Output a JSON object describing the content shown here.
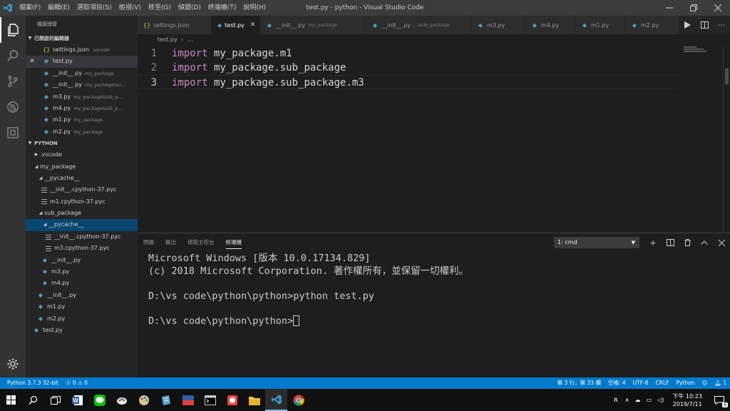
{
  "window": {
    "title": "test.py - python - Visual Studio Code",
    "menus": [
      "檔案(F)",
      "編輯(E)",
      "選取項目(S)",
      "檢視(V)",
      "移至(G)",
      "偵錯(D)",
      "終端機(T)",
      "說明(H)"
    ]
  },
  "sidebar": {
    "title": "檔案總管",
    "open_editors_header": "已開啟的編輯器",
    "open_editors": [
      {
        "name": "settings.json",
        "path": ".vscode",
        "icon": "json-braces-icon"
      },
      {
        "name": "test.py",
        "path": "",
        "icon": "python-icon",
        "close": "✕"
      },
      {
        "name": "__init__.py",
        "path": "my_package",
        "icon": "python-icon"
      },
      {
        "name": "__init__.py",
        "path": "my_package\\su...",
        "icon": "python-icon"
      },
      {
        "name": "m3.py",
        "path": "my_package\\sub_p...",
        "icon": "python-icon"
      },
      {
        "name": "m4.py",
        "path": "my_package\\sub_p...",
        "icon": "python-icon"
      },
      {
        "name": "m1.py",
        "path": "my_package",
        "icon": "python-icon"
      },
      {
        "name": "m2.py",
        "path": "my_package",
        "icon": "python-icon"
      }
    ],
    "folder_header": "PYTHON",
    "tree": [
      {
        "name": ".vscode",
        "kind": "folder-closed"
      },
      {
        "name": "my_package",
        "kind": "folder-open"
      },
      {
        "name": "__pycache__",
        "kind": "folder-open"
      },
      {
        "name": "__init__.cpython-37.pyc",
        "kind": "file-lines"
      },
      {
        "name": "m1.cpython-37.pyc",
        "kind": "file-lines"
      },
      {
        "name": "sub_package",
        "kind": "folder-open"
      },
      {
        "name": "__pycache__",
        "kind": "folder-open"
      },
      {
        "name": "__init__.cpython-37.pyc",
        "kind": "file-lines"
      },
      {
        "name": "m3.cpython-37.pyc",
        "kind": "file-lines"
      },
      {
        "name": "__init__.py",
        "kind": "python"
      },
      {
        "name": "m3.py",
        "kind": "python"
      },
      {
        "name": "m4.py",
        "kind": "python"
      },
      {
        "name": "__init__.py",
        "kind": "python"
      },
      {
        "name": "m1.py",
        "kind": "python"
      },
      {
        "name": "m2.py",
        "kind": "python"
      },
      {
        "name": "test.py",
        "kind": "python"
      }
    ]
  },
  "tabs": [
    {
      "name": "settings.json",
      "path": "",
      "icon": "json-braces-icon"
    },
    {
      "name": "test.py",
      "path": "",
      "icon": "python-icon",
      "close": "✕"
    },
    {
      "name": "__init__.py",
      "path": "my_package",
      "icon": "python-icon"
    },
    {
      "name": "__init__.py",
      "path": "...\\sub_package",
      "icon": "python-icon"
    },
    {
      "name": "m3.py",
      "path": "",
      "icon": "python-icon"
    },
    {
      "name": "m4.py",
      "path": "",
      "icon": "python-icon"
    },
    {
      "name": "m1.py",
      "path": "",
      "icon": "python-icon"
    },
    {
      "name": "m2.py",
      "path": "",
      "icon": "python-icon"
    }
  ],
  "breadcrumb": {
    "file": "test.py",
    "sep": "›",
    "rest": "..."
  },
  "editor": {
    "lines": [
      {
        "no": "1",
        "kw": "import",
        "rest": " my_package.m1"
      },
      {
        "no": "2",
        "kw": "import",
        "rest": " my_package.sub_package"
      },
      {
        "no": "3",
        "kw": "import",
        "rest": " my_package.sub_package.m3"
      }
    ]
  },
  "panel": {
    "tabs": [
      "問題",
      "輸出",
      "偵錯主控台",
      "終端機"
    ],
    "terminal_select": "1: cmd",
    "terminal_lines": [
      "Microsoft Windows [版本 10.0.17134.829]",
      "(c) 2018 Microsoft Corporation. 著作權所有，並保留一切權利。",
      "",
      "D:\\vs code\\python\\python>python test.py",
      "",
      "D:\\vs code\\python\\python>"
    ]
  },
  "status": {
    "interpreter": "Python 3.7.3 32-bit",
    "errors": "0",
    "warnings": "0",
    "position": "第 3 行，第 33 欄",
    "spaces": "空格: 4",
    "encoding": "UTF-8",
    "eol": "CRLF",
    "language": "Python",
    "notifications": "1"
  },
  "taskbar": {
    "time": "下午 10:23",
    "date": "2019/7/11",
    "notif_count": "6"
  },
  "colors": {
    "status_bar": "#007acc",
    "keyword": "#c586c0",
    "python_icon": "#519aba",
    "selection": "#094771"
  }
}
